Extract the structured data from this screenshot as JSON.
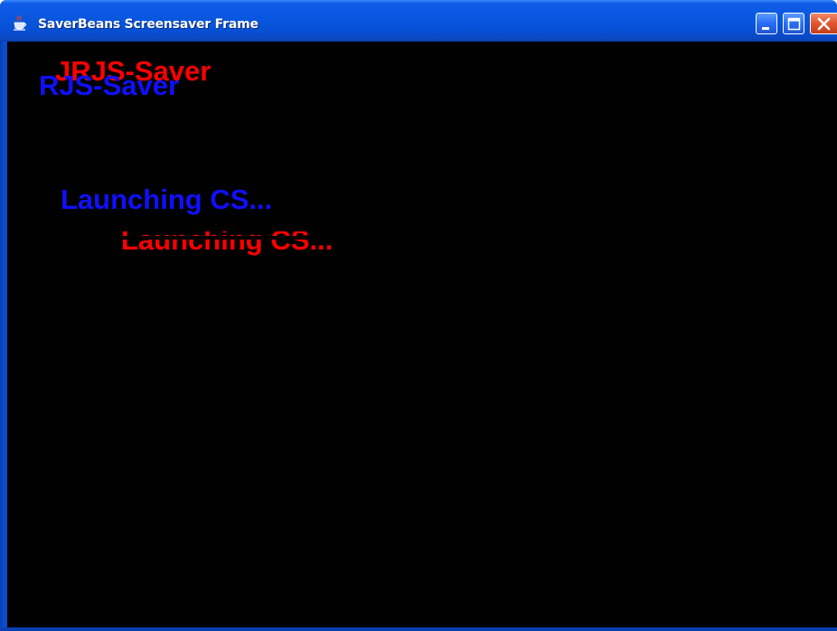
{
  "window": {
    "title": "SaverBeans Screensaver Frame",
    "app_icon": "java-icon",
    "buttons": {
      "minimize_icon": "minimize-icon",
      "maximize_icon": "maximize-icon",
      "close_icon": "close-icon"
    }
  },
  "screensaver": {
    "background_color": "#000000",
    "texts": [
      {
        "text": "JRJS-Saver",
        "color": "#ff0000"
      },
      {
        "text": "RJS-Saver",
        "color": "#1010ff"
      },
      {
        "text": "Launching CS...",
        "color": "#1010ff"
      },
      {
        "text": "Launching CS...",
        "color": "#ff0000"
      }
    ]
  }
}
